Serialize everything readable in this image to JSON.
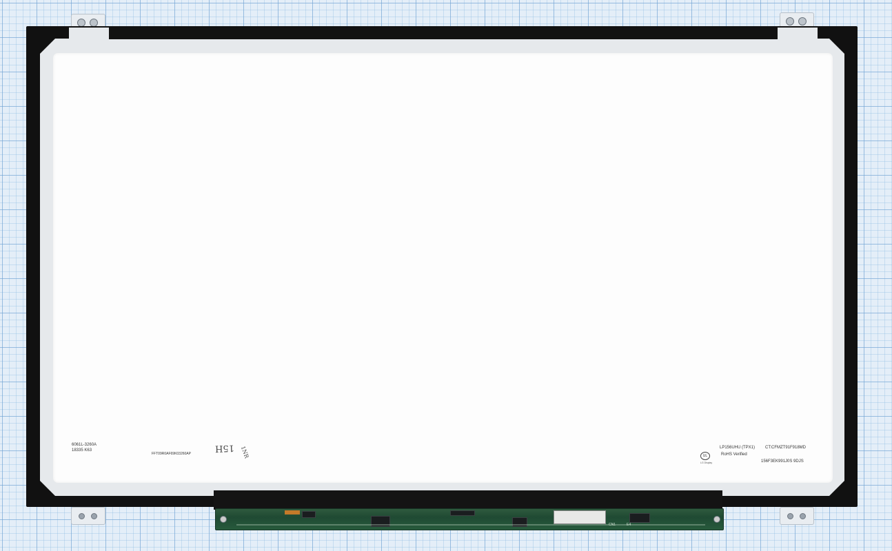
{
  "label_left": {
    "line1": "6061L-3260A",
    "line2": "18335  K63",
    "barcode_text": "FFT09R0AF69K03260AP"
  },
  "handwriting": {
    "mark1": "15H",
    "mark2": "1NR"
  },
  "label_right": {
    "model": "LP156UHU (TPX1)",
    "ct_code": "CT:CFMZT91F918MD",
    "rohs": "RoHS Verified",
    "serial": "156F3EK991J0S 9DJS",
    "ul_mark": "UL",
    "brand_mark": "LG Display"
  },
  "pcb": {
    "cn_label": "CN1",
    "part_label": "E4"
  },
  "colors": {
    "grid_paper": "#e4eef8",
    "bezel": "#111111",
    "frame": "#e6e9ec",
    "screen": "#fdfdfd",
    "pcb": "#2f5a3e"
  }
}
